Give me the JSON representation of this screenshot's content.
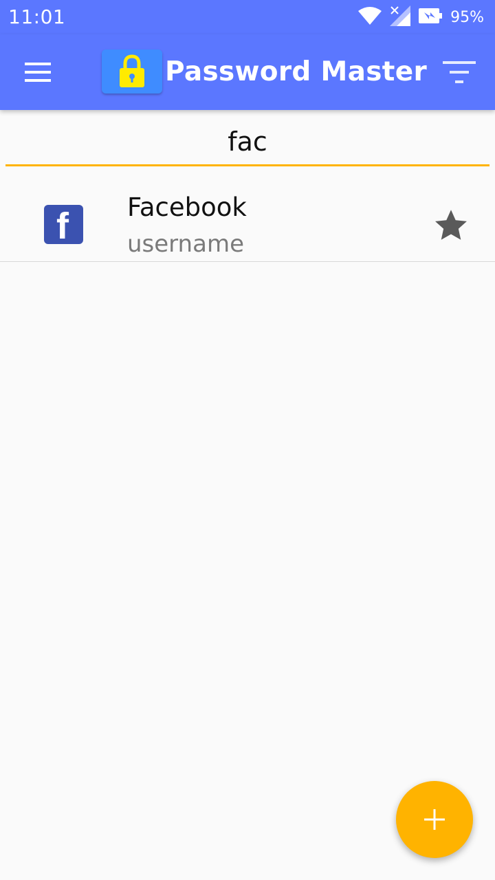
{
  "status_bar": {
    "time": "11:01",
    "battery": "95%",
    "icons": [
      "wifi-icon",
      "signal-icon",
      "battery-icon"
    ]
  },
  "app_bar": {
    "title": "Password Master",
    "icons": [
      "menu-icon",
      "lock-icon",
      "filter-icon"
    ],
    "color": "#5b77ff"
  },
  "search": {
    "value": "fac",
    "underline_color": "#ffb300"
  },
  "results": [
    {
      "title": "Facebook",
      "subtitle": "username",
      "icon": "facebook-icon",
      "favorite": true
    }
  ],
  "fab": {
    "icon": "plus-icon",
    "color": "#ffb300"
  }
}
